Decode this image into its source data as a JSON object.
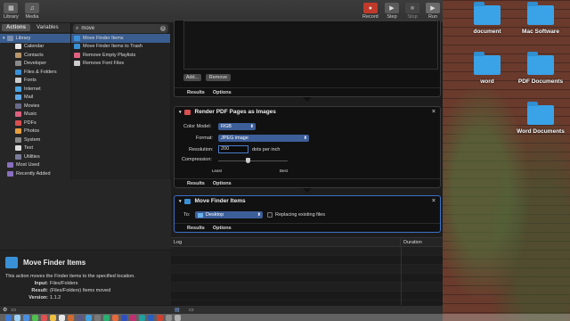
{
  "toolbar": {
    "library_label": "Library",
    "media_label": "Media",
    "record_label": "Record",
    "step_label": "Step",
    "stop_label": "Stop",
    "run_label": "Run"
  },
  "library": {
    "tab_actions": "Actions",
    "tab_variables": "Variables",
    "root": "Library",
    "items": [
      "Calendar",
      "Contacts",
      "Developer",
      "Files & Folders",
      "Fonts",
      "Internet",
      "Mail",
      "Movies",
      "Music",
      "PDFs",
      "Photos",
      "System",
      "Text",
      "Utilities"
    ],
    "most_used": "Most Used",
    "recently_added": "Recently Added"
  },
  "search": {
    "value": "move"
  },
  "actions": [
    "Move Finder Items",
    "Move Finder Items to Trash",
    "Remove Empty Playlists",
    "Remove Font Files"
  ],
  "description": {
    "title": "Move Finder Items",
    "text": "This action moves the Finder items to the specified location.",
    "input_label": "Input:",
    "input_value": "Files/Folders",
    "result_label": "Result:",
    "result_value": "(Files/Folders) Items moved",
    "version_label": "Version:",
    "version_value": "1.1.2"
  },
  "block1": {
    "add_label": "Add...",
    "remove_label": "Remove",
    "results": "Results",
    "options": "Options"
  },
  "block2": {
    "title": "Render PDF Pages as Images",
    "color_model_label": "Color Model:",
    "color_model_value": "RGB",
    "format_label": "Format:",
    "format_value": "JPEG image",
    "resolution_label": "Resolution:",
    "resolution_value": "200",
    "resolution_unit": "dots per inch",
    "compression_label": "Compression:",
    "compression_least": "Least",
    "compression_best": "Best",
    "results": "Results",
    "options": "Options"
  },
  "block3": {
    "title": "Move Finder Items",
    "to_label": "To:",
    "to_value": "Desktop",
    "replace_label": "Replacing existing files",
    "results": "Results",
    "options": "Options"
  },
  "log": {
    "col_log": "Log",
    "col_duration": "Duration"
  },
  "desktop": [
    "document",
    "Mac Software",
    "word",
    "PDF Documents",
    "Word Documents"
  ]
}
